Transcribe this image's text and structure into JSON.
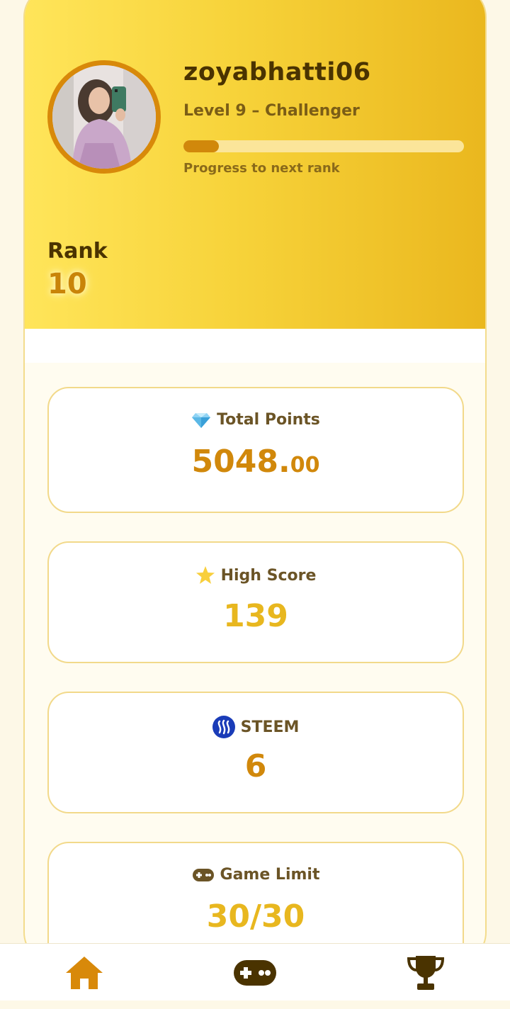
{
  "profile": {
    "username": "zoyabhatti06",
    "level_text": "Level 9 – Challenger",
    "progress_label": "Progress to next rank",
    "progress_fraction": 0.125,
    "avatar_icon": "profile-photo",
    "accent_color": "#d1880b"
  },
  "rank": {
    "label": "Rank",
    "value": "10"
  },
  "stats": {
    "total_points": {
      "title": "Total Points",
      "icon": "gem-icon",
      "value_int": "5048.",
      "value_dec": "00"
    },
    "high_score": {
      "title": "High Score",
      "icon": "star-icon",
      "value": "139"
    },
    "steem": {
      "title": "STEEM",
      "icon": "steem-icon",
      "value": "6"
    },
    "game_limit": {
      "title": "Game Limit",
      "icon": "gamepad-icon",
      "value": "30/30"
    }
  },
  "nav": {
    "items": [
      {
        "icon": "home-icon",
        "color": "#d8890a"
      },
      {
        "icon": "gamepad-icon",
        "color": "#4a3300"
      },
      {
        "icon": "trophy-icon",
        "color": "#4a3300"
      }
    ]
  }
}
